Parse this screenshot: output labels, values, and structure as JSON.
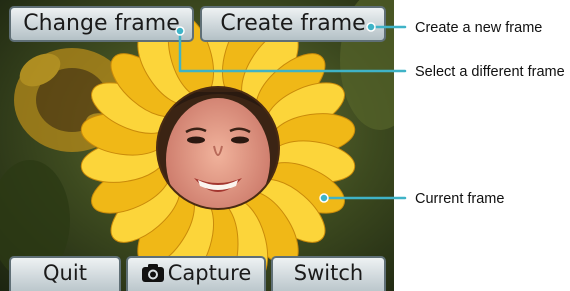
{
  "top_buttons": {
    "change_frame": "Change frame",
    "create_frame": "Create frame"
  },
  "bottom_buttons": {
    "quit": "Quit",
    "capture": "Capture",
    "switch": "Switch",
    "capture_icon": "camera-icon"
  },
  "callouts": {
    "create": "Create a new frame",
    "select": "Select a different frame",
    "current": "Current frame"
  },
  "colors": {
    "callout_line": "#3fb3c7",
    "button_border": "#5f6f76",
    "petal": "#f3c21a"
  }
}
